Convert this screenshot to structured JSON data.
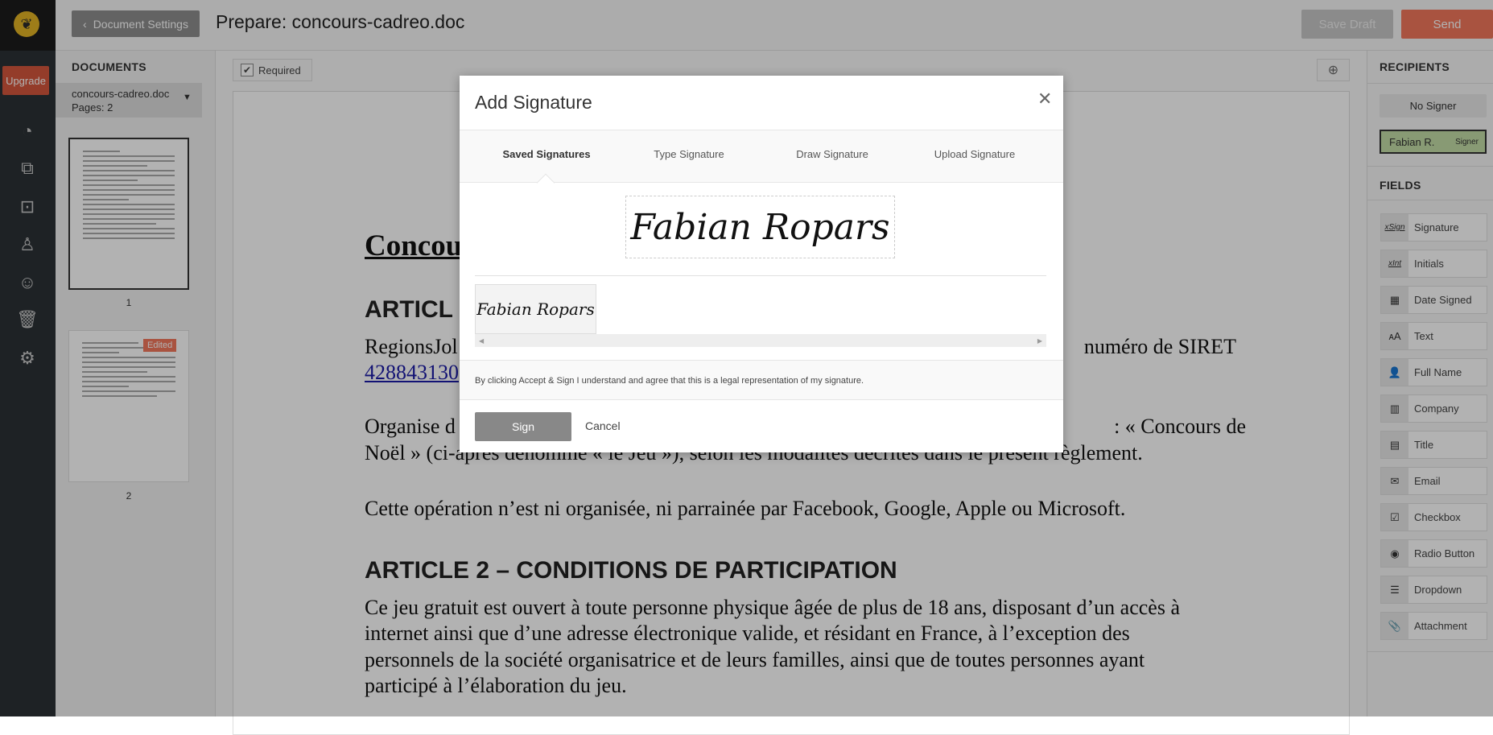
{
  "nav": {
    "upgrade": "Upgrade",
    "icons": [
      "dashboard-icon",
      "documents-icon",
      "templates-icon",
      "team-icon",
      "contacts-icon",
      "trash-icon",
      "settings-icon"
    ]
  },
  "header": {
    "back_label": "Document Settings",
    "title": "Prepare: concours-cadreo.doc",
    "save_draft": "Save Draft",
    "send": "Send"
  },
  "documents": {
    "heading": "DOCUMENTS",
    "item_name": "concours-cadreo.doc",
    "item_pages": "Pages: 2",
    "thumbs": [
      {
        "label": "1"
      },
      {
        "label": "2",
        "badge": "Edited"
      }
    ]
  },
  "toolbar": {
    "required": "Required"
  },
  "document": {
    "title": "Concou",
    "article1": "ARTICL",
    "p1_left": "RegionsJol",
    "p1_right": "numéro de SIRET",
    "p1_link": "428843130",
    "p2_left": "Organise d",
    "p2_right": ": « Concours de",
    "p2_line2": "Noël » (ci-après dénommé « le Jeu »), selon les modalités décrites dans le présent règlement.",
    "p3": "Cette opération n’est ni organisée, ni parrainée par Facebook, Google, Apple ou Microsoft.",
    "article2": "ARTICLE 2 – CONDITIONS DE PARTICIPATION",
    "p4": [
      "Ce jeu gratuit est ouvert à toute personne physique âgée de plus de 18 ans, disposant d’un accès à",
      "internet ainsi que d’une adresse électronique valide, et résidant en France, à l’exception des",
      "personnels de la société organisatrice et de leurs familles, ainsi que de toutes personnes ayant",
      "participé à l’élaboration du jeu."
    ]
  },
  "recipients": {
    "heading": "RECIPIENTS",
    "no_signer": "No Signer",
    "signer_name": "Fabian R.",
    "signer_role": "Signer",
    "signer_color": "#c3dda6"
  },
  "fields": {
    "heading": "FIELDS",
    "items": [
      {
        "label": "Signature",
        "icon": "xSign"
      },
      {
        "label": "Initials",
        "icon": "xInt"
      },
      {
        "label": "Date Signed",
        "icon": "▦"
      },
      {
        "label": "Text",
        "icon": "ᴀA"
      },
      {
        "label": "Full Name",
        "icon": "👤"
      },
      {
        "label": "Company",
        "icon": "▥"
      },
      {
        "label": "Title",
        "icon": "▤"
      },
      {
        "label": "Email",
        "icon": "✉"
      },
      {
        "label": "Checkbox",
        "icon": "☑"
      },
      {
        "label": "Radio Button",
        "icon": "◉"
      },
      {
        "label": "Dropdown",
        "icon": "☰"
      },
      {
        "label": "Attachment",
        "icon": "📎"
      }
    ]
  },
  "modal": {
    "title": "Add Signature",
    "tabs": [
      "Saved Signatures",
      "Type Signature",
      "Draw Signature",
      "Upload Signature"
    ],
    "active_tab": "Saved Signatures",
    "signature": "Fabian Ropars",
    "saved": [
      "Fabian Ropars"
    ],
    "disclaimer": "By clicking Accept & Sign I understand and agree that this is a legal representation of my signature.",
    "sign": "Sign",
    "cancel": "Cancel"
  },
  "colors": {
    "accent": "#f2775c",
    "logo": "#e2b324",
    "nav": "#2b3136"
  }
}
